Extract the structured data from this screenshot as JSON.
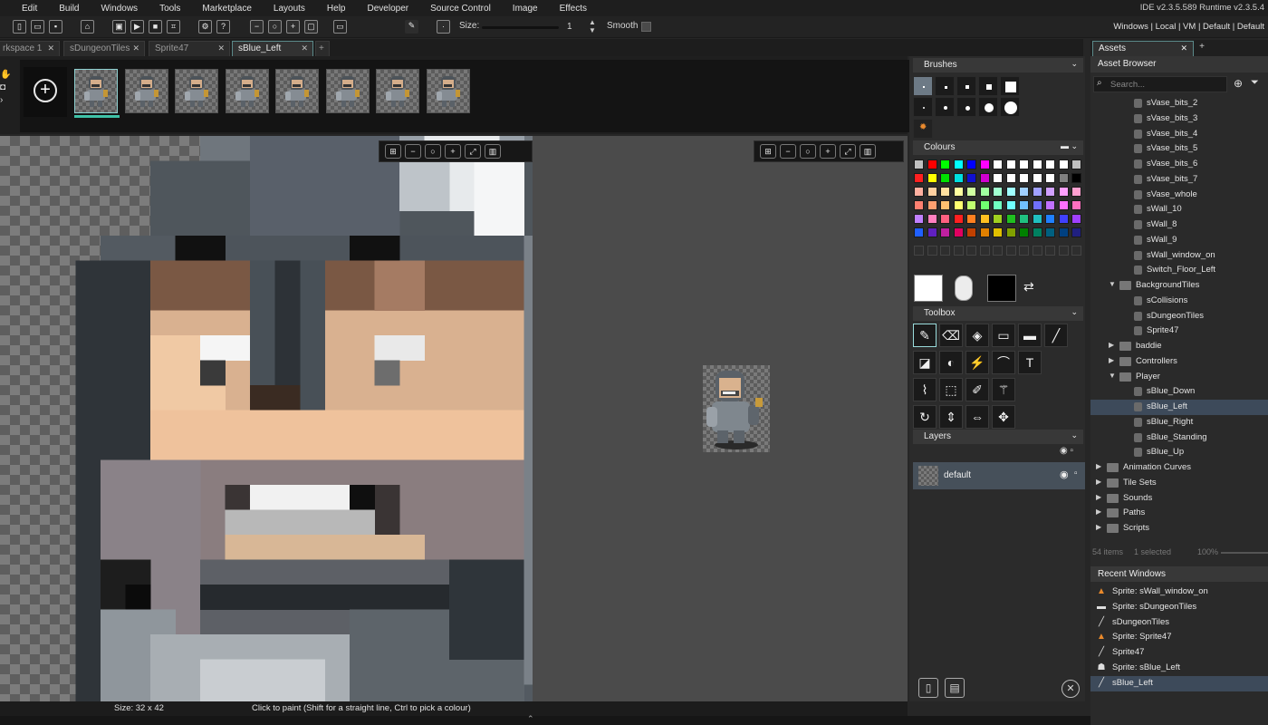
{
  "menu": {
    "items": [
      "Edit",
      "Build",
      "Windows",
      "Tools",
      "Marketplace",
      "Layouts",
      "Help",
      "Developer",
      "Source Control",
      "Image",
      "Effects"
    ],
    "version": "IDE v2.3.5.589  Runtime v2.3.5.4"
  },
  "toolbar": {
    "size_label": "Size:",
    "size_value": "1",
    "smooth_label": "Smooth",
    "right_links": "Windows | Local | VM | Default | Default"
  },
  "doc_tabs": [
    {
      "label": "rkspace 1"
    },
    {
      "label": "sDungeonTiles"
    },
    {
      "label": "Sprite47"
    },
    {
      "label": "sBlue_Left"
    }
  ],
  "frames": {
    "count": 8,
    "selected": 1
  },
  "status": {
    "size": "Size: 32 x 42",
    "hint": "Click to paint (Shift for a straight line, Ctrl to pick a colour)"
  },
  "panels": {
    "brushes_title": "Brushes",
    "colours_title": "Colours",
    "toolbox_title": "Toolbox",
    "layers_title": "Layers",
    "layer_name": "default"
  },
  "colours": {
    "primary": "#ffffff",
    "secondary": "#000000",
    "palette": [
      [
        "#c0c0c0",
        "#ff0000",
        "#00ff00",
        "#00ffff",
        "#0000ff",
        "#ff00ff",
        "#ffffff",
        "#ffffff",
        "#ffffff",
        "#ffffff",
        "#ffffff",
        "#ffffff",
        "#c0c0c0"
      ],
      [
        "#ff2020",
        "#ffff00",
        "#00e000",
        "#00e0e0",
        "#1010d0",
        "#d000d0",
        "#ffffff",
        "#ffffff",
        "#ffffff",
        "#ffffff",
        "#ffffff",
        "#808080",
        "#000000"
      ],
      [
        "#ffb0a0",
        "#ffd0a0",
        "#ffe0a0",
        "#ffffa0",
        "#d0ffa0",
        "#a0ffa0",
        "#a0ffd0",
        "#a0ffff",
        "#a0d0ff",
        "#a0a0ff",
        "#d0a0ff",
        "#ffa0ff",
        "#ffa0d0"
      ],
      [
        "#ff8070",
        "#ffa070",
        "#ffc070",
        "#ffff70",
        "#c0ff70",
        "#70ff70",
        "#70ffc0",
        "#70ffff",
        "#70c0ff",
        "#7070ff",
        "#c070ff",
        "#ff70ff",
        "#ff70c0"
      ],
      [
        "#c080ff",
        "#ff80c0",
        "#ff6080",
        "#ff2020",
        "#ff8020",
        "#ffc020",
        "#a0d020",
        "#20c020",
        "#20c080",
        "#20c0c0",
        "#2080ff",
        "#4040ff",
        "#a040ff"
      ],
      [
        "#2060ff",
        "#6020c0",
        "#c020a0",
        "#e00060",
        "#c04000",
        "#e08000",
        "#e0c000",
        "#80a000",
        "#008000",
        "#008060",
        "#006080",
        "#004080",
        "#202080"
      ]
    ]
  },
  "assets": {
    "tab_label": "Assets",
    "header": "Asset Browser",
    "search_placeholder": "Search...",
    "rows": [
      {
        "label": "sVase_bits_2",
        "indent": 3,
        "type": "sprite"
      },
      {
        "label": "sVase_bits_3",
        "indent": 3,
        "type": "sprite"
      },
      {
        "label": "sVase_bits_4",
        "indent": 3,
        "type": "sprite"
      },
      {
        "label": "sVase_bits_5",
        "indent": 3,
        "type": "sprite"
      },
      {
        "label": "sVase_bits_6",
        "indent": 3,
        "type": "sprite"
      },
      {
        "label": "sVase_bits_7",
        "indent": 3,
        "type": "sprite"
      },
      {
        "label": "sVase_whole",
        "indent": 3,
        "type": "sprite"
      },
      {
        "label": "sWall_10",
        "indent": 3,
        "type": "sprite"
      },
      {
        "label": "sWall_8",
        "indent": 3,
        "type": "sprite"
      },
      {
        "label": "sWall_9",
        "indent": 3,
        "type": "sprite"
      },
      {
        "label": "sWall_window_on",
        "indent": 3,
        "type": "sprite"
      },
      {
        "label": "Switch_Floor_Left",
        "indent": 3,
        "type": "sprite"
      },
      {
        "label": "BackgroundTiles",
        "indent": 2,
        "type": "folder-open"
      },
      {
        "label": "sCollisions",
        "indent": 3,
        "type": "sprite"
      },
      {
        "label": "sDungeonTiles",
        "indent": 3,
        "type": "sprite"
      },
      {
        "label": "Sprite47",
        "indent": 3,
        "type": "sprite"
      },
      {
        "label": "baddie",
        "indent": 2,
        "type": "folder-closed"
      },
      {
        "label": "Controllers",
        "indent": 2,
        "type": "folder-closed"
      },
      {
        "label": "Player",
        "indent": 2,
        "type": "folder-open"
      },
      {
        "label": "sBlue_Down",
        "indent": 3,
        "type": "sprite"
      },
      {
        "label": "sBlue_Left",
        "indent": 3,
        "type": "sprite",
        "selected": true
      },
      {
        "label": "sBlue_Right",
        "indent": 3,
        "type": "sprite"
      },
      {
        "label": "sBlue_Standing",
        "indent": 3,
        "type": "sprite"
      },
      {
        "label": "sBlue_Up",
        "indent": 3,
        "type": "sprite"
      },
      {
        "label": "Animation Curves",
        "indent": 1,
        "type": "folder-closed"
      },
      {
        "label": "Tile Sets",
        "indent": 1,
        "type": "folder-closed"
      },
      {
        "label": "Sounds",
        "indent": 1,
        "type": "folder-closed"
      },
      {
        "label": "Paths",
        "indent": 1,
        "type": "folder-closed"
      },
      {
        "label": "Scripts",
        "indent": 1,
        "type": "folder-closed"
      }
    ],
    "footer_items": "54 items",
    "footer_selected": "1 selected",
    "footer_zoom": "100%"
  },
  "recent": {
    "header": "Recent Windows",
    "items": [
      {
        "label": "Sprite: sWall_window_on",
        "icon": "flame-icon"
      },
      {
        "label": "Sprite: sDungeonTiles",
        "icon": "tiles-icon"
      },
      {
        "label": "sDungeonTiles",
        "icon": "brush-icon"
      },
      {
        "label": "Sprite: Sprite47",
        "icon": "flame-icon"
      },
      {
        "label": "Sprite47",
        "icon": "brush-icon"
      },
      {
        "label": "Sprite: sBlue_Left",
        "icon": "knight-icon"
      },
      {
        "label": "sBlue_Left",
        "icon": "brush-icon",
        "selected": true
      }
    ]
  }
}
